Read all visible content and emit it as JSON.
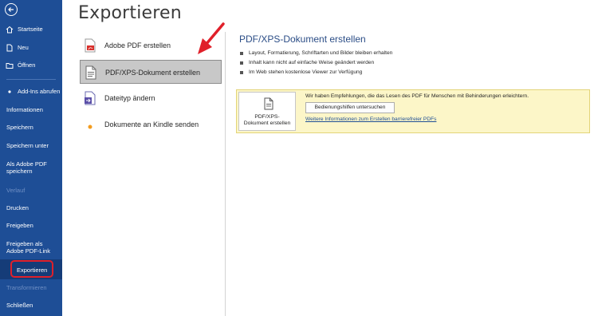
{
  "page": {
    "title": "Exportieren"
  },
  "sidebar": {
    "top_items": [
      {
        "label": "Startseite",
        "icon": "home-icon"
      },
      {
        "label": "Neu",
        "icon": "new-document-icon"
      },
      {
        "label": "Öffnen",
        "icon": "folder-open-icon"
      }
    ],
    "items": [
      {
        "label": "Add-Ins abrufen",
        "icon": "add-ins-bullet-icon"
      },
      {
        "label": "Informationen"
      },
      {
        "label": "Speichern"
      },
      {
        "label": "Speichern unter"
      },
      {
        "label_line1": "Als Adobe PDF",
        "label_line2": "speichern"
      },
      {
        "label": "Verlauf",
        "disabled": true
      },
      {
        "label": "Drucken"
      },
      {
        "label": "Freigeben"
      },
      {
        "label_line1": "Freigeben als",
        "label_line2": "Adobe PDF-Link"
      },
      {
        "label": "Exportieren",
        "selected": true
      },
      {
        "label": "Transformieren",
        "disabled": true
      },
      {
        "label": "Schließen"
      }
    ]
  },
  "options": [
    {
      "label": "Adobe PDF erstellen",
      "icon": "adobe-pdf-icon"
    },
    {
      "label": "PDF/XPS-Dokument erstellen",
      "icon": "pdf-xps-document-icon",
      "selected": true
    },
    {
      "label": "Dateityp ändern",
      "icon": "change-file-type-icon"
    },
    {
      "label": "Dokumente an Kindle senden",
      "icon": "kindle-bullet-icon"
    }
  ],
  "detail": {
    "title": "PDF/XPS-Dokument erstellen",
    "bullets": [
      "Layout, Formatierung, Schriftarten und Bilder bleiben erhalten",
      "Inhalt kann nicht auf einfache Weise geändert werden",
      "Im Web stehen kostenlose Viewer zur Verfügung"
    ],
    "create_button_line1": "PDF/XPS-",
    "create_button_line2": "Dokument erstellen",
    "recommendation": "Wir haben Empfehlungen, die das Lesen des PDF für Menschen mit Behinderungen erleichtern.",
    "check_button": "Bedienungshilfen untersuchen",
    "link": "Weitere Informationen zum Erstellen barrierefreier PDFs"
  },
  "colors": {
    "sidebar_bg": "#1e4e96",
    "sidebar_selected": "#153c78",
    "highlight_ring": "#e0202a",
    "recommendation_bg": "#fcf6c8",
    "link": "#1e4e96",
    "annotation_arrow": "#e0202a"
  }
}
